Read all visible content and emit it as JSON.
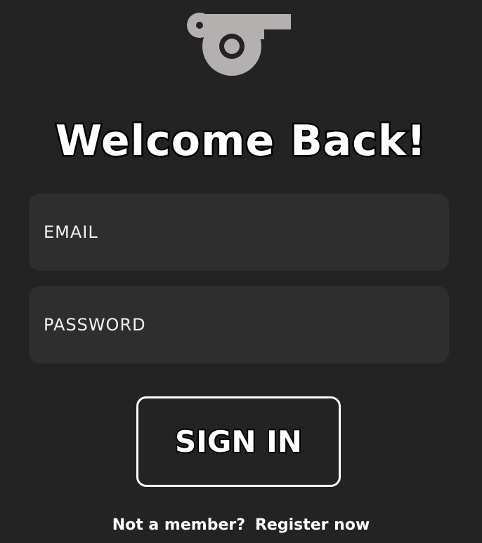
{
  "logo": {
    "icon": "whistle-icon",
    "color": "#b3b0af"
  },
  "title": "Welcome Back!",
  "form": {
    "email_label": "EMAIL",
    "password_label": "PASSWORD",
    "field_bg": "#2e2e2e"
  },
  "signin_button": {
    "label": "SIGN IN"
  },
  "footer": {
    "prompt": "Not a member?",
    "register_link": "Register now"
  },
  "colors": {
    "background": "#232323",
    "text": "#ffffff",
    "outline": "#000000"
  }
}
